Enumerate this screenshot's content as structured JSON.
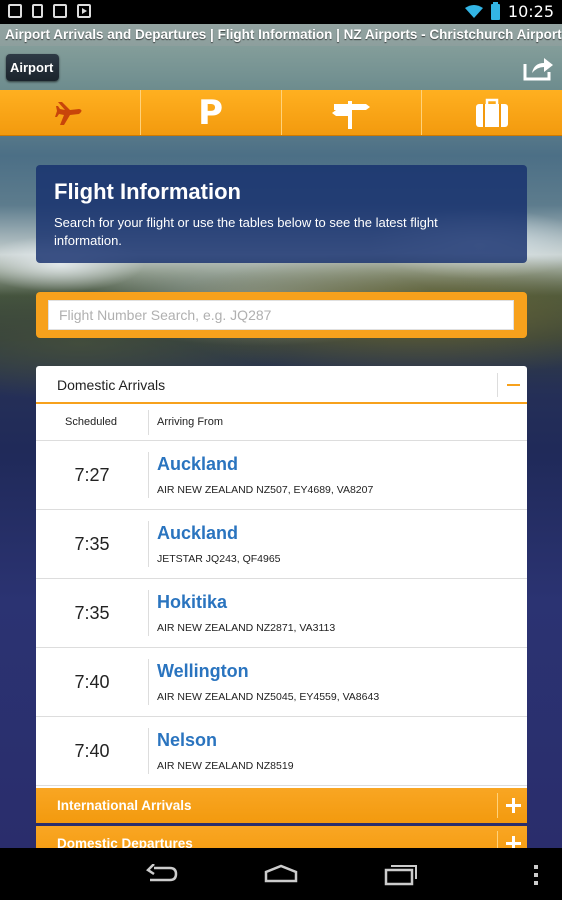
{
  "status_bar": {
    "time": "10:25",
    "icons": [
      "image-icon",
      "document-icon",
      "store-icon",
      "play-store-icon",
      "wifi-icon",
      "battery-icon"
    ]
  },
  "window_title": "Airport Arrivals and Departures | Flight Information | NZ Airports - Christchurch Airport",
  "topbar": {
    "airport_button": "Airport",
    "share_icon": "share-icon"
  },
  "nav": {
    "items": [
      {
        "name": "flights",
        "icon": "airplane-icon"
      },
      {
        "name": "parking",
        "icon": "parking-icon",
        "label": "P"
      },
      {
        "name": "directions",
        "icon": "signpost-icon"
      },
      {
        "name": "shopping",
        "icon": "luggage-icon"
      }
    ]
  },
  "info_panel": {
    "title": "Flight Information",
    "text": "Search for your flight or use the tables below to see the latest flight information."
  },
  "search": {
    "placeholder": "Flight Number Search, e.g. JQ287",
    "value": ""
  },
  "domestic_arrivals": {
    "title": "Domestic Arrivals",
    "expanded": true,
    "columns": {
      "scheduled": "Scheduled",
      "from": "Arriving From"
    },
    "rows": [
      {
        "time": "7:27",
        "city": "Auckland",
        "flights": "AIR NEW ZEALAND NZ507, EY4689, VA8207"
      },
      {
        "time": "7:35",
        "city": "Auckland",
        "flights": "JETSTAR JQ243, QF4965"
      },
      {
        "time": "7:35",
        "city": "Hokitika",
        "flights": "AIR NEW ZEALAND NZ2871, VA3113"
      },
      {
        "time": "7:40",
        "city": "Wellington",
        "flights": "AIR NEW ZEALAND NZ5045, EY4559, VA8643"
      },
      {
        "time": "7:40",
        "city": "Nelson",
        "flights": "AIR NEW ZEALAND NZ8519"
      }
    ]
  },
  "international_arrivals": {
    "title": "International Arrivals",
    "expanded": false
  },
  "domestic_departures": {
    "title": "Domestic Departures",
    "expanded": false
  },
  "colors": {
    "accent": "#f7a11c",
    "link": "#2a74bf",
    "panel": "#16306e"
  }
}
